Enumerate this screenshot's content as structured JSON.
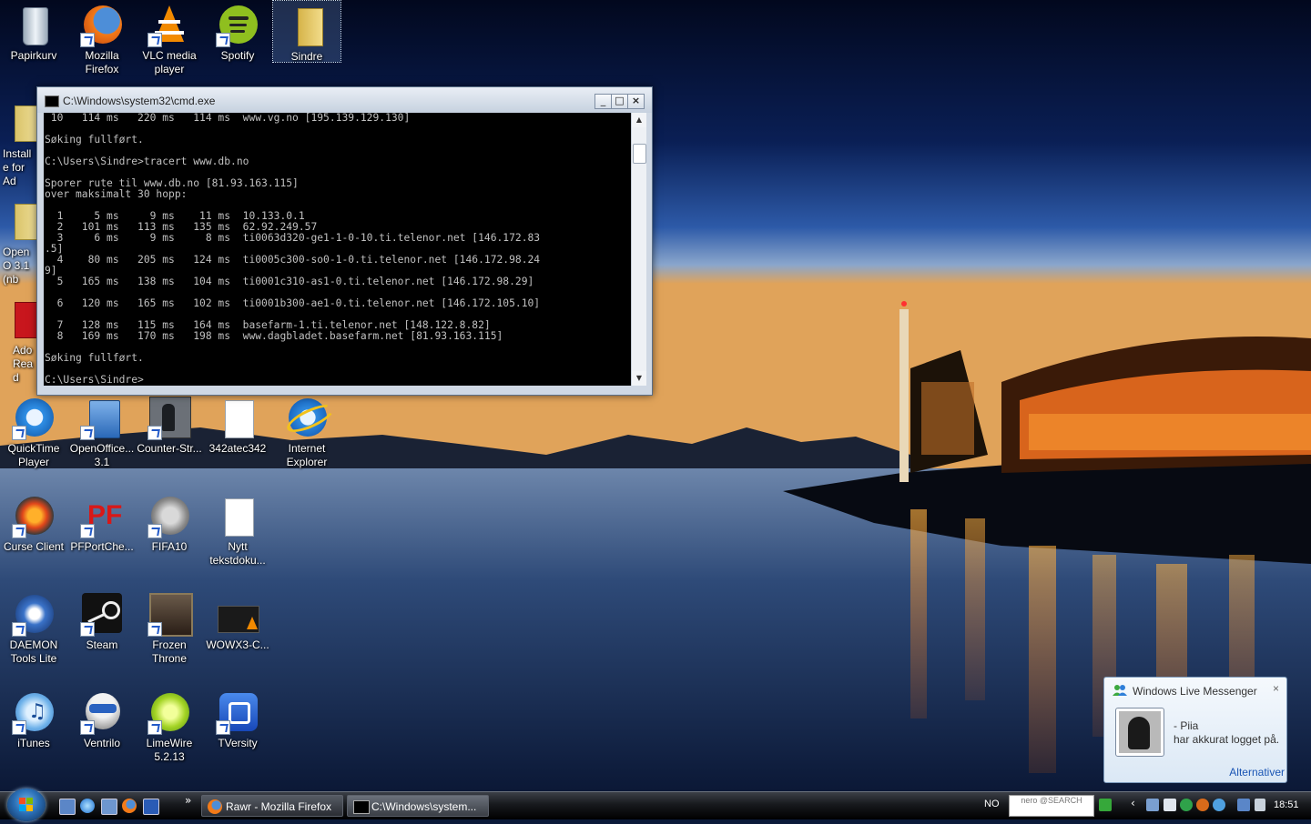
{
  "desktop": {
    "icons": [
      {
        "label": "Papirkurv",
        "icon": "recycle-bin-icon"
      },
      {
        "label": "Mozilla Firefox",
        "icon": "firefox-icon"
      },
      {
        "label": "VLC media player",
        "icon": "vlc-icon"
      },
      {
        "label": "Spotify",
        "icon": "spotify-icon"
      },
      {
        "label": "Sindre",
        "icon": "user-folder-icon"
      },
      {
        "label": "Installe for Ad",
        "icon": "installer-icon"
      },
      {
        "label": "OpenO 3.1 (nb",
        "icon": "openoffice-folder-icon"
      },
      {
        "label": "Ado Read",
        "icon": "adobe-reader-icon"
      },
      {
        "label": "QuickTime Player",
        "icon": "quicktime-icon"
      },
      {
        "label": "OpenOffice... 3.1",
        "icon": "openoffice-icon"
      },
      {
        "label": "Counter-Str...",
        "icon": "counter-strike-icon"
      },
      {
        "label": "342atec342",
        "icon": "text-file-icon"
      },
      {
        "label": "Internet Explorer",
        "icon": "internet-explorer-icon"
      },
      {
        "label": "Curse Client",
        "icon": "curse-client-icon"
      },
      {
        "label": "PFPortChe...",
        "icon": "pfportchecker-icon"
      },
      {
        "label": "FIFA10",
        "icon": "fifa10-icon"
      },
      {
        "label": "Nytt tekstdoku...",
        "icon": "text-file-icon"
      },
      {
        "label": "DAEMON Tools Lite",
        "icon": "daemon-tools-icon"
      },
      {
        "label": "Steam",
        "icon": "steam-icon"
      },
      {
        "label": "Frozen Throne",
        "icon": "frozen-throne-icon"
      },
      {
        "label": "WOWX3-C...",
        "icon": "video-file-icon"
      },
      {
        "label": "iTunes",
        "icon": "itunes-icon"
      },
      {
        "label": "Ventrilo",
        "icon": "ventrilo-icon"
      },
      {
        "label": "LimeWire 5.2.13",
        "icon": "limewire-icon"
      },
      {
        "label": "TVersity",
        "icon": "tversity-icon"
      }
    ]
  },
  "cmd": {
    "title": "C:\\Windows\\system32\\cmd.exe",
    "min_label": "_",
    "max_label": "□",
    "close_label": "×",
    "lines": [
      " 10   114 ms   220 ms   114 ms  www.vg.no [195.139.129.130]",
      "",
      "Søking fullført.",
      "",
      "C:\\Users\\Sindre>tracert www.db.no",
      "",
      "Sporer rute til www.db.no [81.93.163.115]",
      "over maksimalt 30 hopp:",
      "",
      "  1     5 ms     9 ms    11 ms  10.133.0.1",
      "  2   101 ms   113 ms   135 ms  62.92.249.57",
      "  3     6 ms     9 ms     8 ms  ti0063d320-ge1-1-0-10.ti.telenor.net [146.172.83",
      ".5]",
      "  4    80 ms   205 ms   124 ms  ti0005c300-so0-1-0.ti.telenor.net [146.172.98.24",
      "9]",
      "  5   165 ms   138 ms   104 ms  ti0001c310-as1-0.ti.telenor.net [146.172.98.29]",
      "",
      "  6   120 ms   165 ms   102 ms  ti0001b300-ae1-0.ti.telenor.net [146.172.105.10]",
      "",
      "  7   128 ms   115 ms   164 ms  basefarm-1.ti.telenor.net [148.122.8.82]",
      "  8   169 ms   170 ms   198 ms  www.dagbladet.basefarm.net [81.93.163.115]",
      "",
      "Søking fullført.",
      "",
      "C:\\Users\\Sindre>"
    ]
  },
  "messenger_toast": {
    "title": "Windows Live Messenger",
    "close_label": "×",
    "contact": "- Piia",
    "message": "har akkurat logget på.",
    "options_link": "Alternativer"
  },
  "taskbar": {
    "overflow_label": "»",
    "tasks": [
      {
        "label": "Rawr - Mozilla Firefox",
        "icon": "firefox-icon"
      },
      {
        "label": "C:\\Windows\\system...",
        "icon": "cmd-icon"
      }
    ],
    "language": "NO",
    "search_label": "nero @SEARCH",
    "clock": "18:51"
  }
}
